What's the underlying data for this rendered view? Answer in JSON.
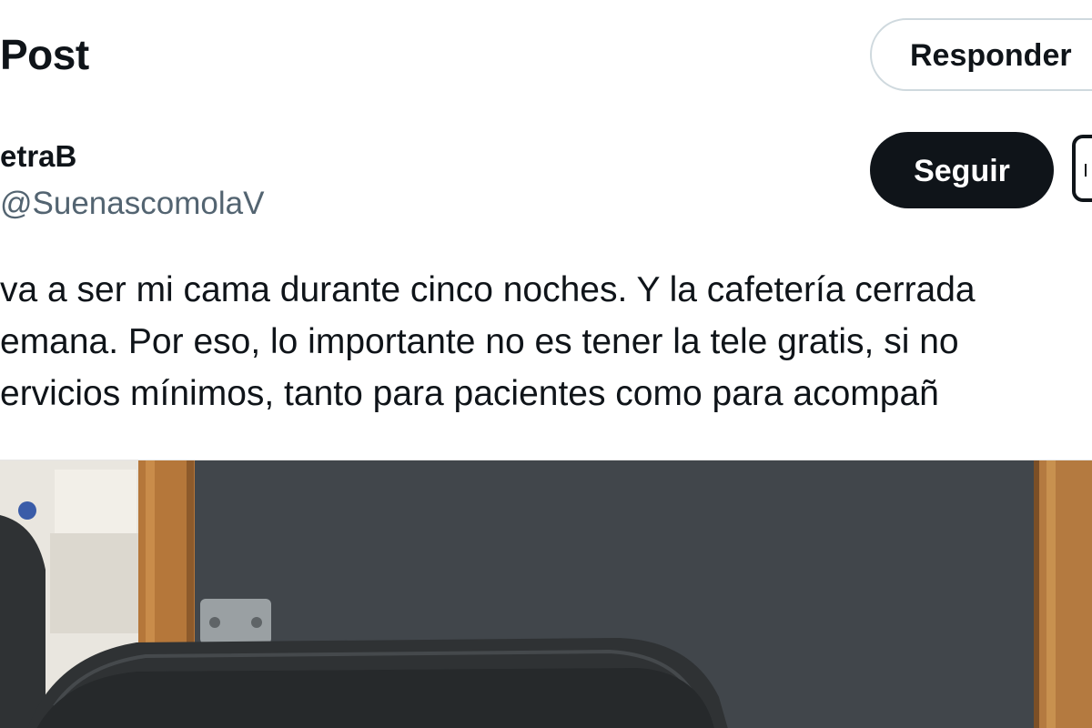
{
  "header": {
    "title": "Post",
    "reply_label": "Responder"
  },
  "author": {
    "display_name": "etraB",
    "handle": "@SuenascomolaV",
    "follow_label": "Seguir",
    "more_icon": "more-options-icon"
  },
  "post": {
    "lines": [
      "va a ser mi cama durante cinco noches. Y la cafetería cerrada",
      "emana. Por eso, lo importante no es tener la tele gratis, si no",
      "ervicios mínimos, tanto para pacientes como para acompañ"
    ]
  },
  "media": {
    "description_icon": "photo-hospital-chair",
    "colors": {
      "wall": "#3e4346",
      "wood": "#b5773a",
      "chair": "#2f3234",
      "left_wall": "#e9e6df"
    }
  }
}
